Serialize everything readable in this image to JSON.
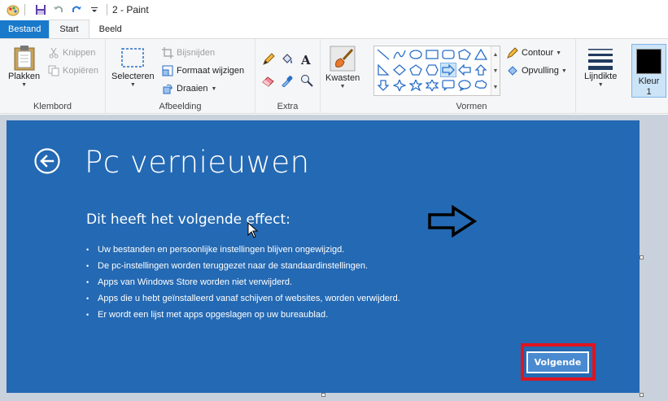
{
  "window": {
    "title": "2 - Paint"
  },
  "tabs": [
    {
      "label": "Bestand"
    },
    {
      "label": "Start"
    },
    {
      "label": "Beeld"
    }
  ],
  "ribbon": {
    "clipboard": {
      "paste": "Plakken",
      "cut": "Knippen",
      "copy": "Kopiëren",
      "group": "Klembord"
    },
    "image": {
      "select": "Selecteren",
      "crop": "Bijsnijden",
      "resize": "Formaat wijzigen",
      "rotate": "Draaien",
      "group": "Afbeelding"
    },
    "tools": {
      "group": "Extra"
    },
    "brushes": {
      "label": "Kwasten"
    },
    "shapes": {
      "outline": "Contour",
      "fill": "Opvulling",
      "group": "Vormen"
    },
    "size": {
      "label": "Lijndikte"
    },
    "color": {
      "label": "Kleur",
      "index": "1",
      "value": "#000000"
    }
  },
  "canvas": {
    "title": "Pc vernieuwen",
    "subtitle": "Dit heeft het volgende effect:",
    "bullets": [
      "Uw bestanden en persoonlijke instellingen blijven ongewijzigd.",
      "De pc-instellingen worden teruggezet naar de standaardinstellingen.",
      "Apps van Windows Store worden niet verwijderd.",
      "Apps die u hebt geïnstalleerd vanaf schijven of websites, worden verwijderd.",
      "Er wordt een lijst met apps opgeslagen op uw bureaublad."
    ],
    "next_button": "Volgende",
    "background": "#2469b3",
    "highlight_color": "#e0141e"
  }
}
